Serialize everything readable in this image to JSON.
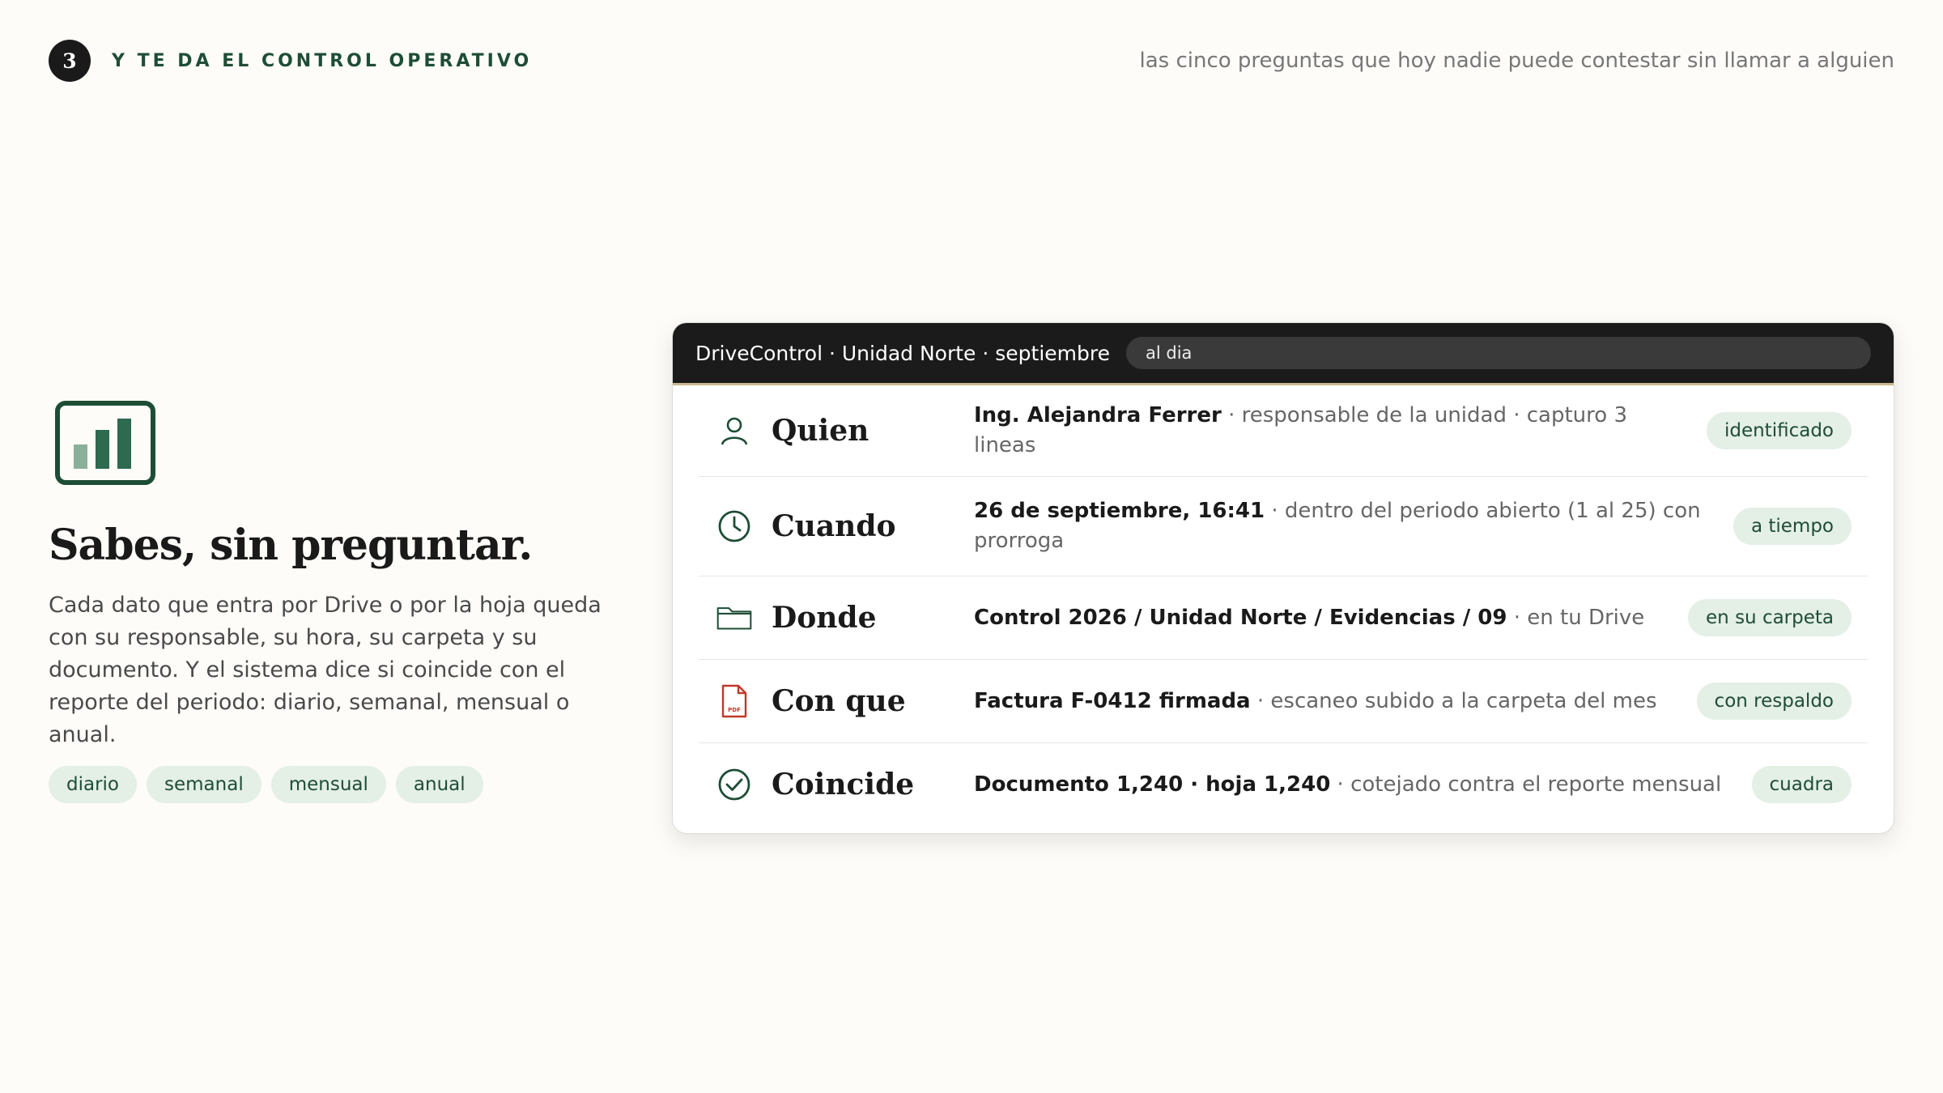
{
  "header": {
    "step_number": "3",
    "step_label": "Y TE DA EL CONTROL OPERATIVO",
    "tagline": "las cinco preguntas que hoy nadie puede contestar sin llamar a alguien"
  },
  "left": {
    "icon": "bar-chart-icon",
    "headline": "Sabes, sin preguntar.",
    "body": "Cada dato que entra por Drive o por la hoja queda con su responsable, su hora, su carpeta y su documento. Y el sistema dice si coincide con el reporte del periodo: diario, semanal, mensual o anual.",
    "chips": [
      "diario",
      "semanal",
      "mensual",
      "anual"
    ]
  },
  "panel": {
    "title": "DriveControl · Unidad Norte · septiembre",
    "status": "al dia",
    "rows": [
      {
        "icon": "person-icon",
        "label": "Quien",
        "strong": "Ing. Alejandra Ferrer",
        "detail": " · responsable de la unidad · capturo 3 lineas",
        "badge": "identificado"
      },
      {
        "icon": "clock-icon",
        "label": "Cuando",
        "strong": "26 de septiembre, 16:41",
        "detail": " · dentro del periodo abierto (1 al 25) con prorroga",
        "badge": "a tiempo"
      },
      {
        "icon": "folder-icon",
        "label": "Donde",
        "strong": "Control 2026 / Unidad Norte / Evidencias / 09",
        "detail": " · en tu Drive",
        "badge": "en su carpeta"
      },
      {
        "icon": "pdf-file-icon",
        "label": "Con que",
        "strong": "Factura F-0412 firmada",
        "detail": " · escaneo subido a la carpeta del mes",
        "badge": "con respaldo"
      },
      {
        "icon": "check-circle-icon",
        "label": "Coincide",
        "strong": "Documento 1,240 · hoja 1,240",
        "detail": " · cotejado contra el reporte mensual",
        "badge": "cuadra"
      }
    ]
  },
  "colors": {
    "accent": "#1e4d36",
    "badge_bg": "#e4efe6",
    "background": "#fdfcf8",
    "panel_header": "#1b1b1b",
    "pdf_red": "#c0392b"
  }
}
